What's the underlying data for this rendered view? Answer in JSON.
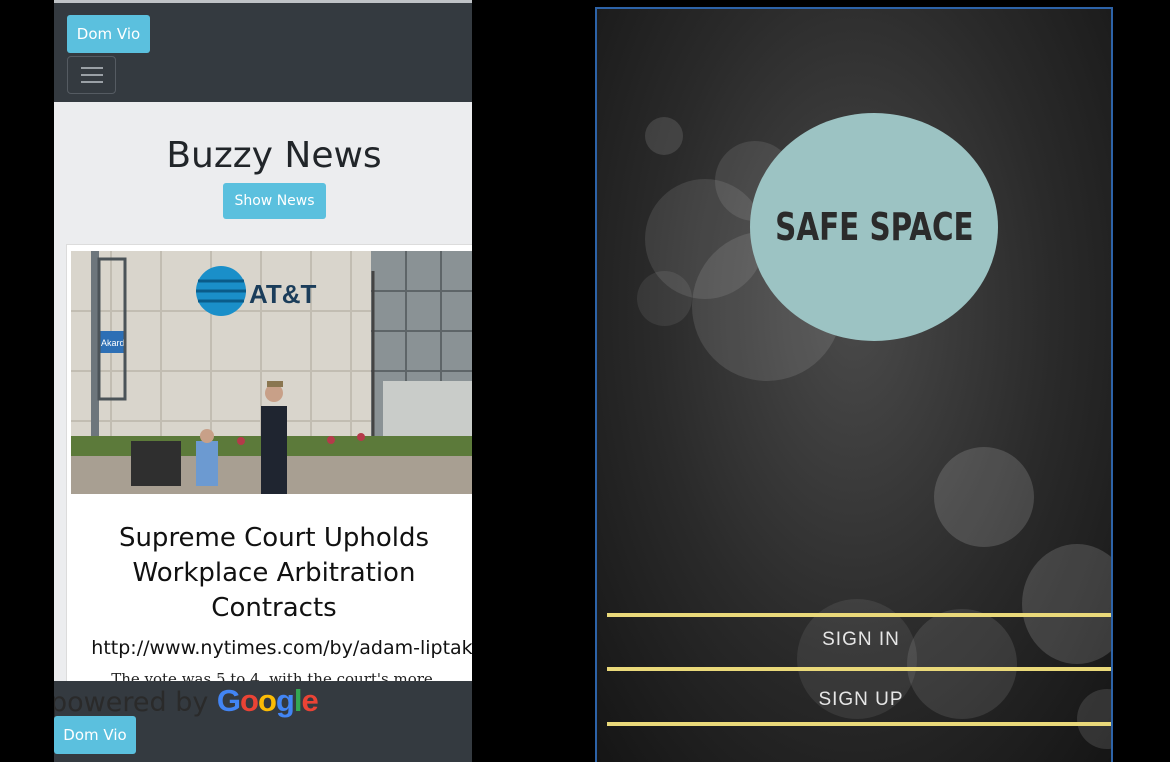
{
  "news_app": {
    "navbar": {
      "brand_label": "Dom Vio"
    },
    "title": "Buzzy News",
    "show_button": "Show News",
    "article": {
      "image_alt": "AT&T building",
      "image_sign_text": "AT&T",
      "street_sign": "Akard",
      "headline": "Supreme Court Upholds Workplace Arbitration Contracts",
      "link": "http://www.nytimes.com/by/adam-liptak",
      "snippet": "The vote was 5 to 4, with the court's more"
    },
    "footer": {
      "powered_by": "powered by",
      "google": "Google",
      "brand_label": "Dom Vio"
    }
  },
  "safe_space_app": {
    "logo_text": "SAFE SPACE",
    "sign_in": "SIGN IN",
    "sign_up": "SIGN UP",
    "accent_color": "#ead97a"
  }
}
